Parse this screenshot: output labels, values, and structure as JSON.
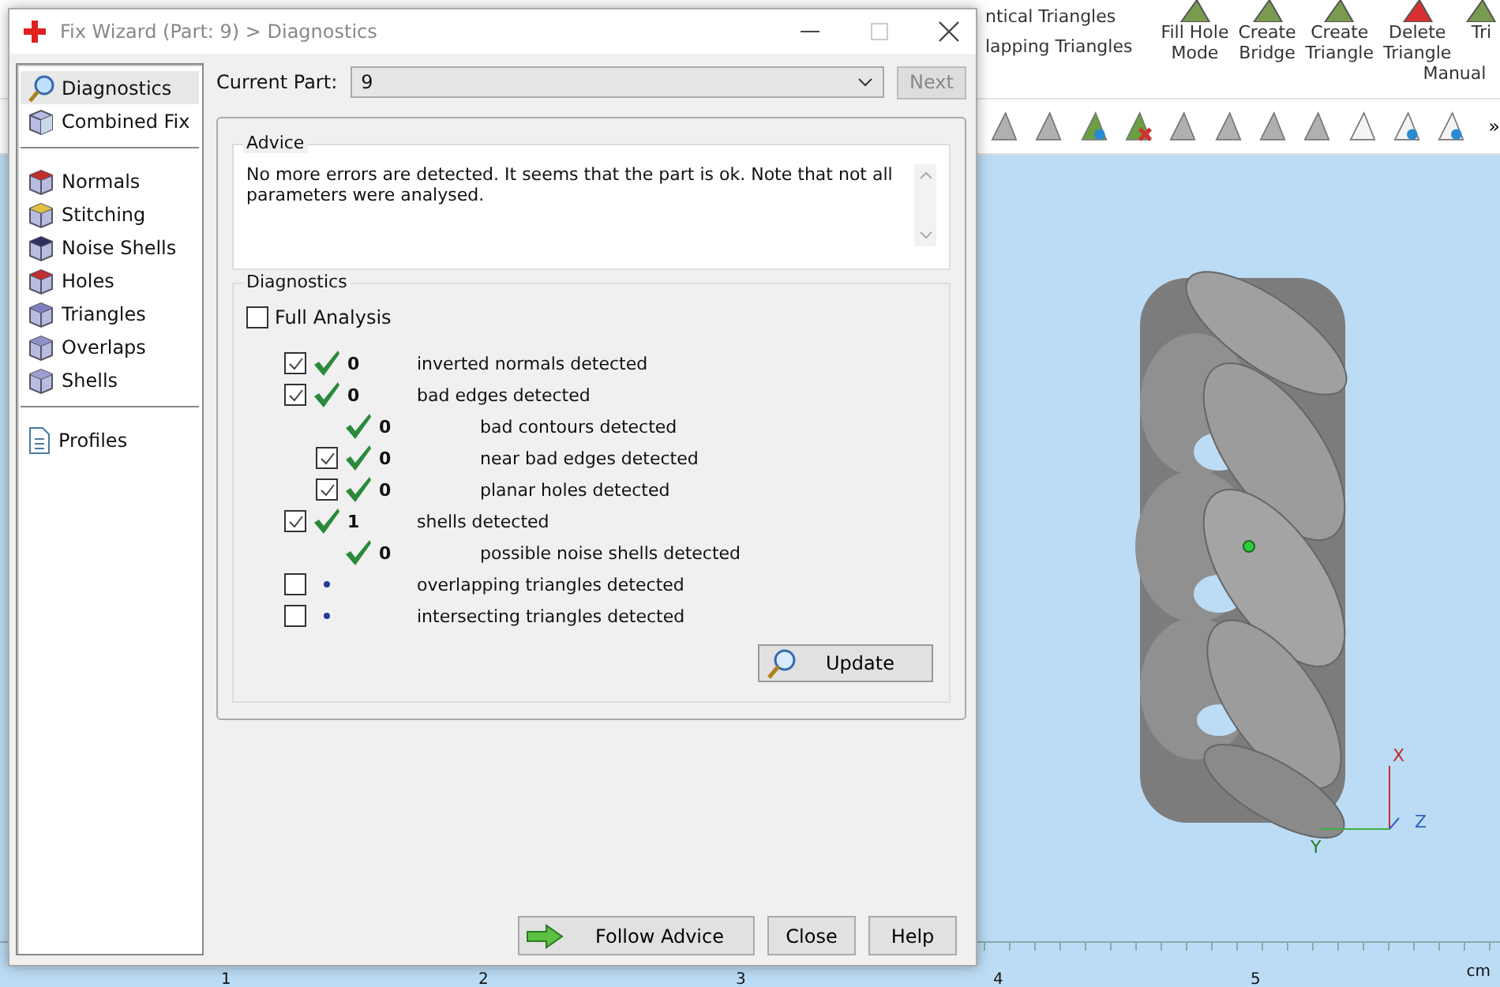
{
  "app": {
    "ribbon_texts": [
      "ntical Triangles",
      "lapping Triangles"
    ],
    "ribbon_buttons": [
      "Fill Hole\nMode",
      "Create\nBridge",
      "Create\nTriangle",
      "Delete\nTriangle",
      "Tri"
    ],
    "ribbon_group": "Manual",
    "overflow": "»",
    "axes": [
      "X",
      "Y",
      "Z"
    ],
    "ruler": [
      "1",
      "2",
      "3",
      "4",
      "5"
    ],
    "ruler_unit": "cm"
  },
  "window": {
    "title": "Fix Wizard (Part: 9) > Diagnostics"
  },
  "sidebar": {
    "groups": [
      [
        {
          "label": "Diagnostics",
          "selected": true
        },
        {
          "label": "Combined Fix",
          "selected": false
        }
      ],
      [
        {
          "label": "Normals",
          "selected": false
        },
        {
          "label": "Stitching",
          "selected": false
        },
        {
          "label": "Noise Shells",
          "selected": false
        },
        {
          "label": "Holes",
          "selected": false
        },
        {
          "label": "Triangles",
          "selected": false
        },
        {
          "label": "Overlaps",
          "selected": false
        },
        {
          "label": "Shells",
          "selected": false
        }
      ],
      [
        {
          "label": "Profiles",
          "selected": false
        }
      ]
    ]
  },
  "current_part": {
    "label": "Current Part:",
    "value": "9",
    "next": "Next",
    "next_disabled": true
  },
  "advice": {
    "title": "Advice",
    "text": "No more errors are detected. It seems that the part is ok. Note that not all parameters were analysed."
  },
  "diagnostics": {
    "title": "Diagnostics",
    "full_analysis": {
      "label": "Full Analysis",
      "checked": false
    },
    "rows": [
      {
        "checked": true,
        "passed": true,
        "count": "0",
        "label": "inverted normals detected"
      },
      {
        "checked": true,
        "passed": true,
        "count": "0",
        "label": "bad edges detected",
        "children": [
          {
            "passed": true,
            "count": "0",
            "label": "bad contours detected"
          },
          {
            "checked": true,
            "passed": true,
            "count": "0",
            "label": "near bad edges detected"
          },
          {
            "checked": true,
            "passed": true,
            "count": "0",
            "label": "planar holes detected"
          }
        ]
      },
      {
        "checked": true,
        "passed": true,
        "count": "1",
        "label": "shells detected",
        "children": [
          {
            "passed": true,
            "count": "0",
            "label": "possible noise shells detected"
          }
        ]
      },
      {
        "checked": false,
        "passed": false,
        "label": "overlapping triangles detected"
      },
      {
        "checked": false,
        "passed": false,
        "label": "intersecting triangles detected"
      }
    ],
    "update": "Update"
  },
  "buttons": [
    "Follow Advice",
    "Close",
    "Help"
  ]
}
